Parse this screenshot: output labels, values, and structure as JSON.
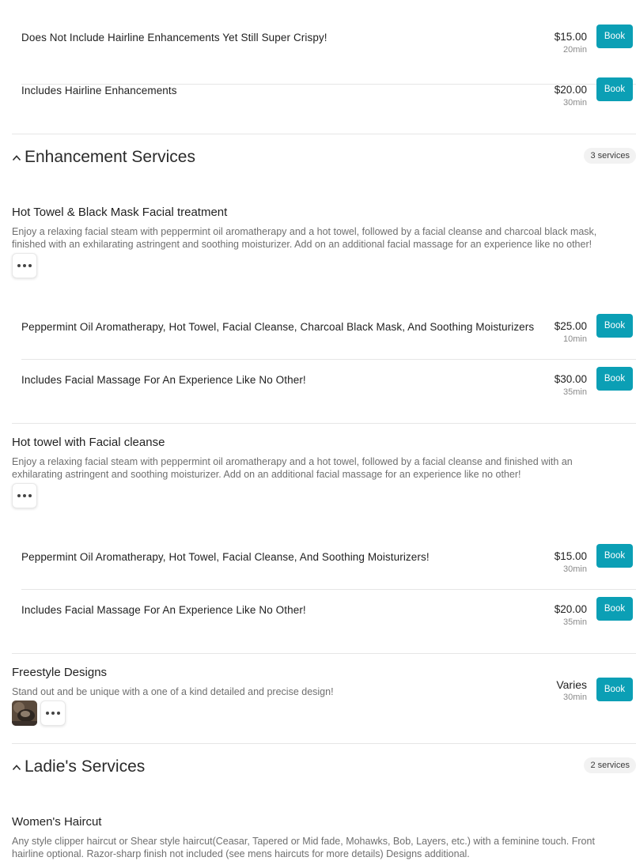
{
  "top_variants": [
    {
      "name": "Does Not Include Hairline Enhancements Yet Still Super Crispy!",
      "price": "$15.00",
      "duration": "20min",
      "book": "Book"
    },
    {
      "name": "Includes Hairline Enhancements",
      "price": "$20.00",
      "duration": "30min",
      "book": "Book"
    }
  ],
  "enhancement": {
    "title": "Enhancement Services",
    "count": "3 services",
    "services": [
      {
        "title": "Hot Towel & Black Mask Facial treatment",
        "description": "Enjoy a relaxing facial steam with peppermint oil aromatherapy and a hot towel, followed by a facial cleanse and charcoal black mask, finished with an exhilarating astringent and soothing moisturizer. Add on an additional facial massage for an experience like no other!",
        "variants": [
          {
            "name": "Peppermint Oil Aromatherapy, Hot Towel, Facial Cleanse, Charcoal Black Mask, And Soothing Moisturizers",
            "price": "$25.00",
            "duration": "10min",
            "book": "Book"
          },
          {
            "name": "Includes Facial Massage For An Experience Like No Other!",
            "price": "$30.00",
            "duration": "35min",
            "book": "Book"
          }
        ]
      },
      {
        "title": "Hot towel with Facial cleanse",
        "description": "Enjoy a relaxing facial steam with peppermint oil aromatherapy and a hot towel, followed by a facial cleanse and finished with an exhilarating astringent and soothing moisturizer. Add on an additional facial massage for an experience like no other!",
        "variants": [
          {
            "name": "Peppermint Oil Aromatherapy, Hot Towel, Facial Cleanse, And Soothing Moisturizers!",
            "price": "$15.00",
            "duration": "30min",
            "book": "Book"
          },
          {
            "name": "Includes Facial Massage For An Experience Like No Other!",
            "price": "$20.00",
            "duration": "35min",
            "book": "Book"
          }
        ]
      },
      {
        "title": "Freestyle Designs",
        "description": "Stand out and be unique with a one of a kind detailed and precise design!",
        "price": "Varies",
        "duration": "30min",
        "book": "Book"
      }
    ]
  },
  "ladies": {
    "title": "Ladie's Services",
    "count": "2 services",
    "services": [
      {
        "title": "Women's Haircut",
        "description": "Any style clipper haircut or Shear style haircut(Ceasar, Tapered or Mid fade, Mohawks, Bob, Layers, etc.) with a feminine touch. Front hairline optional. Razor-sharp finish not included (see mens haircuts for more details) Designs additional."
      }
    ]
  },
  "colors": {
    "accent": "#0b9fb5",
    "muted_text": "#6f6f6f",
    "divider": "#e6e6e6"
  },
  "icons": {
    "collapse": "chevron-up-icon",
    "more": "more-horizontal-icon"
  }
}
